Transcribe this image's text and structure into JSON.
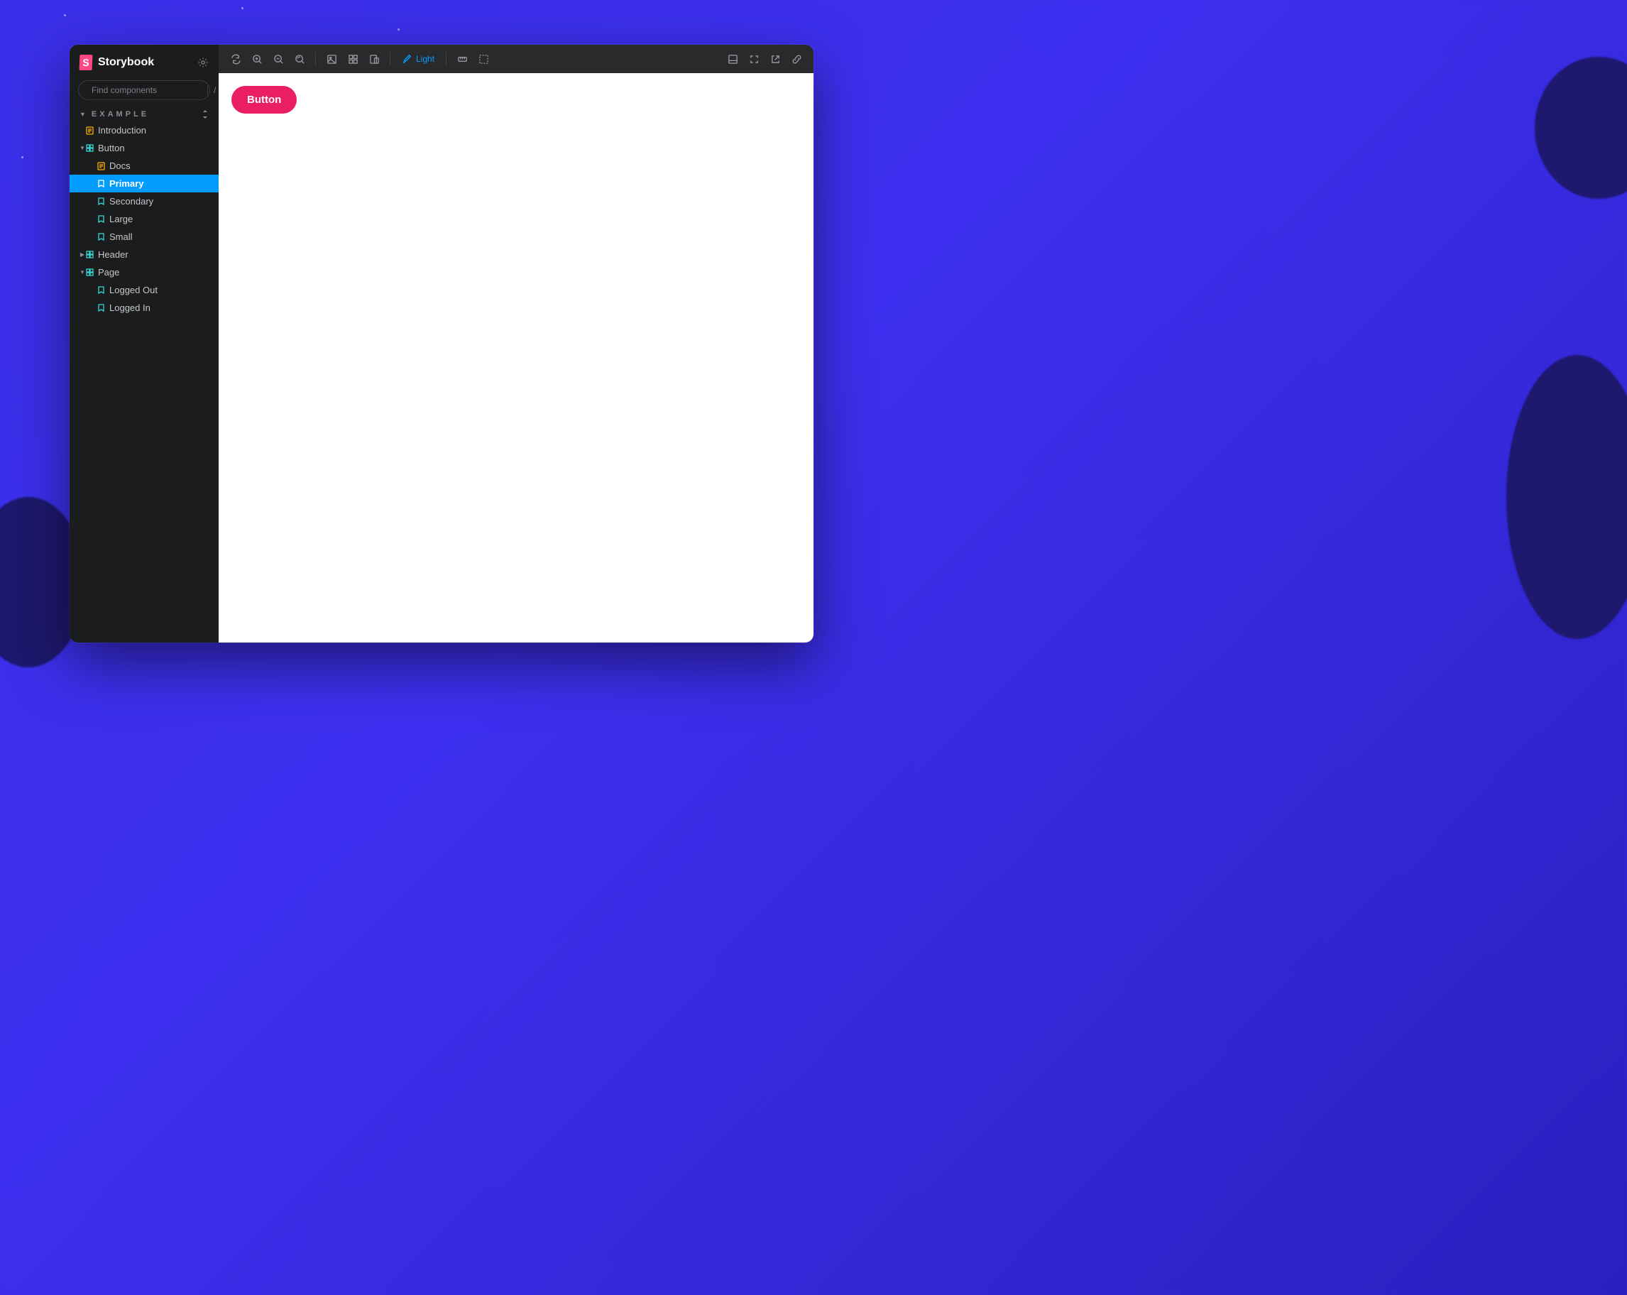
{
  "brand": {
    "name": "Storybook",
    "mark_letter": "S"
  },
  "search": {
    "placeholder": "Find components",
    "shortcut": "/"
  },
  "section": {
    "label": "EXAMPLE"
  },
  "tree": {
    "introduction": "Introduction",
    "button": "Button",
    "button_children": {
      "docs": "Docs",
      "primary": "Primary",
      "secondary": "Secondary",
      "large": "Large",
      "small": "Small"
    },
    "header": "Header",
    "page": "Page",
    "page_children": {
      "logged_out": "Logged Out",
      "logged_in": "Logged In"
    }
  },
  "toolbar": {
    "theme_label": "Light"
  },
  "canvas": {
    "button_label": "Button"
  }
}
